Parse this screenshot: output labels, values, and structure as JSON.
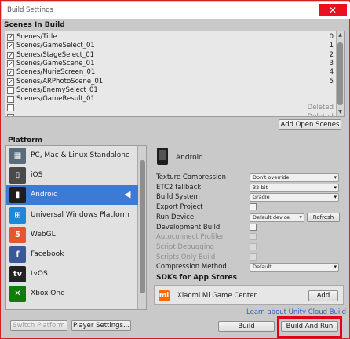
{
  "window": {
    "title": "Build Settings",
    "close_glyph": "✕"
  },
  "scenes": {
    "header": "Scenes In Build",
    "items": [
      {
        "name": "Scenes/Title",
        "checked": true,
        "index": "0"
      },
      {
        "name": "Scenes/GameSelect_01",
        "checked": true,
        "index": "1"
      },
      {
        "name": "Scenes/StageSelect_01",
        "checked": true,
        "index": "2"
      },
      {
        "name": "Scenes/GameScene_01",
        "checked": true,
        "index": "3"
      },
      {
        "name": "Scenes/NurieScreen_01",
        "checked": true,
        "index": "4"
      },
      {
        "name": "Scenes/ARPhotoScene_01",
        "checked": true,
        "index": "5"
      },
      {
        "name": "Scenes/EnemySelect_01",
        "checked": false,
        "index": ""
      },
      {
        "name": "Scenes/GameResult_01",
        "checked": false,
        "index": ""
      }
    ],
    "deleted_rows": [
      "Deleted",
      "Deleted"
    ],
    "add_open_scenes": "Add Open Scenes"
  },
  "platform": {
    "header": "Platform",
    "items": [
      {
        "label": "PC, Mac & Linux Standalone",
        "icon": "pc-mac-linux-icon",
        "color": "#5a6b7c",
        "glyph": "▦",
        "selected": false
      },
      {
        "label": "iOS",
        "icon": "ios-icon",
        "color": "#4a4a4a",
        "glyph": "▯",
        "selected": false
      },
      {
        "label": "Android",
        "icon": "android-icon",
        "color": "#1e1e1e",
        "glyph": "▮",
        "selected": true
      },
      {
        "label": "Universal Windows Platform",
        "icon": "windows-icon",
        "color": "#1e88d8",
        "glyph": "⊞",
        "selected": false
      },
      {
        "label": "WebGL",
        "icon": "html5-icon",
        "color": "#e4572e",
        "glyph": "5",
        "selected": false
      },
      {
        "label": "Facebook",
        "icon": "facebook-icon",
        "color": "#3b5998",
        "glyph": "f",
        "selected": false
      },
      {
        "label": "tvOS",
        "icon": "tvos-icon",
        "color": "#222222",
        "glyph": "tv",
        "selected": false
      },
      {
        "label": "Xbox One",
        "icon": "xbox-icon",
        "color": "#107c10",
        "glyph": "✕",
        "selected": false
      }
    ],
    "selected_badge_glyph": "◀"
  },
  "settings": {
    "title": "Android",
    "rows": [
      {
        "label": "Texture Compression",
        "type": "dropdown",
        "value": "Don't override",
        "dim": false
      },
      {
        "label": "ETC2 fallback",
        "type": "dropdown",
        "value": "32-bit",
        "dim": false
      },
      {
        "label": "Build System",
        "type": "dropdown",
        "value": "Gradle",
        "dim": false
      },
      {
        "label": "Export Project",
        "type": "checkbox",
        "dim": false
      },
      {
        "label": "Run Device",
        "type": "run-device",
        "value": "Default device",
        "refresh": "Refresh",
        "dim": false
      },
      {
        "label": "Development Build",
        "type": "checkbox",
        "dim": false
      },
      {
        "label": "Autoconnect Profiler",
        "type": "checkbox",
        "dim": true
      },
      {
        "label": "Script Debugging",
        "type": "checkbox",
        "dim": true
      },
      {
        "label": "Scripts Only Build",
        "type": "checkbox",
        "dim": true
      },
      {
        "label": "Compression Method",
        "type": "dropdown",
        "value": "Default",
        "dim": false
      }
    ]
  },
  "sdk": {
    "header": "SDKs for App Stores",
    "name": "Xiaomi Mi Game Center",
    "icon_glyph": "mi",
    "add": "Add",
    "link": "Learn about Unity Cloud Build"
  },
  "footer": {
    "switch_platform": "Switch Platform",
    "player_settings": "Player Settings...",
    "build": "Build",
    "build_and_run": "Build And Run"
  },
  "colors": {
    "selection": "#3d7ad6",
    "highlight": "#e0001a",
    "link": "#2a63c9"
  }
}
